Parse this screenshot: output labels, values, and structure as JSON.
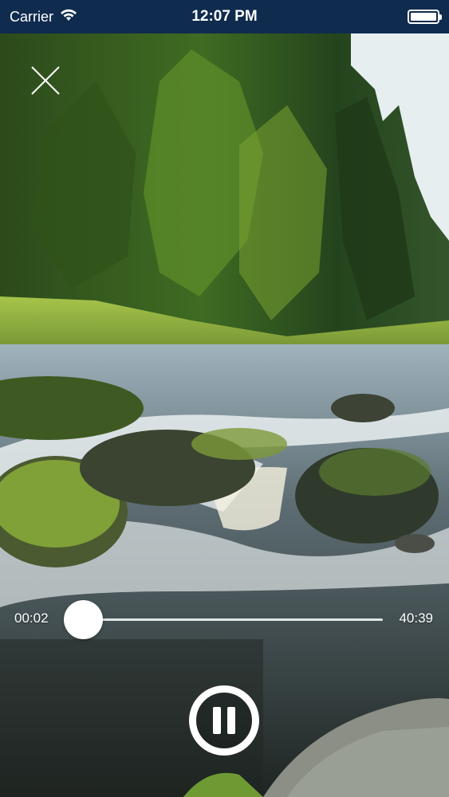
{
  "status_bar": {
    "carrier": "Carrier",
    "time": "12:07 PM",
    "wifi_icon": "wifi-icon",
    "battery_icon": "battery-full-icon"
  },
  "player": {
    "close_icon": "close-icon",
    "elapsed": "00:02",
    "duration": "40:39",
    "progress": 0.0,
    "state_icon": "pause-icon"
  },
  "colors": {
    "status_bar_bg": "#0f2b4e",
    "controls": "#ffffff"
  }
}
